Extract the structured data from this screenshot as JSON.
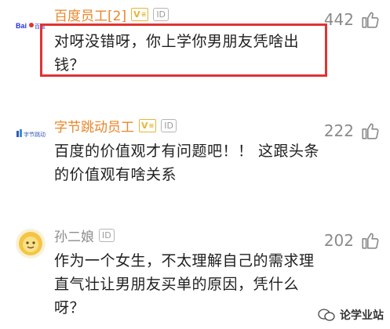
{
  "comments": [
    {
      "author": "百度员工[2]",
      "id_badge": "ID",
      "text": "对呀没错呀，你上学你男朋友凭啥出钱？",
      "likes": "442",
      "avatar_logo": "Baidu百度"
    },
    {
      "author": "字节跳动员工",
      "id_badge": "ID",
      "text": "百度的价值观才有问题吧！！ 这跟头条的价值观有啥关系",
      "likes": "222",
      "avatar_logo": "字节跳动"
    },
    {
      "author": "孙二娘",
      "id_badge": "ID",
      "text": "作为一个女生，不太理解自己的需求理直气壮让男朋友买单的原因，凭什么呀？",
      "likes": "202",
      "avatar_logo": ""
    }
  ],
  "watermark": "论学业站",
  "colors": {
    "verified_name": "#e8862a",
    "plain_name": "#8c8c8c",
    "highlight_border": "#e03334",
    "v_badge": "#e8b534"
  }
}
